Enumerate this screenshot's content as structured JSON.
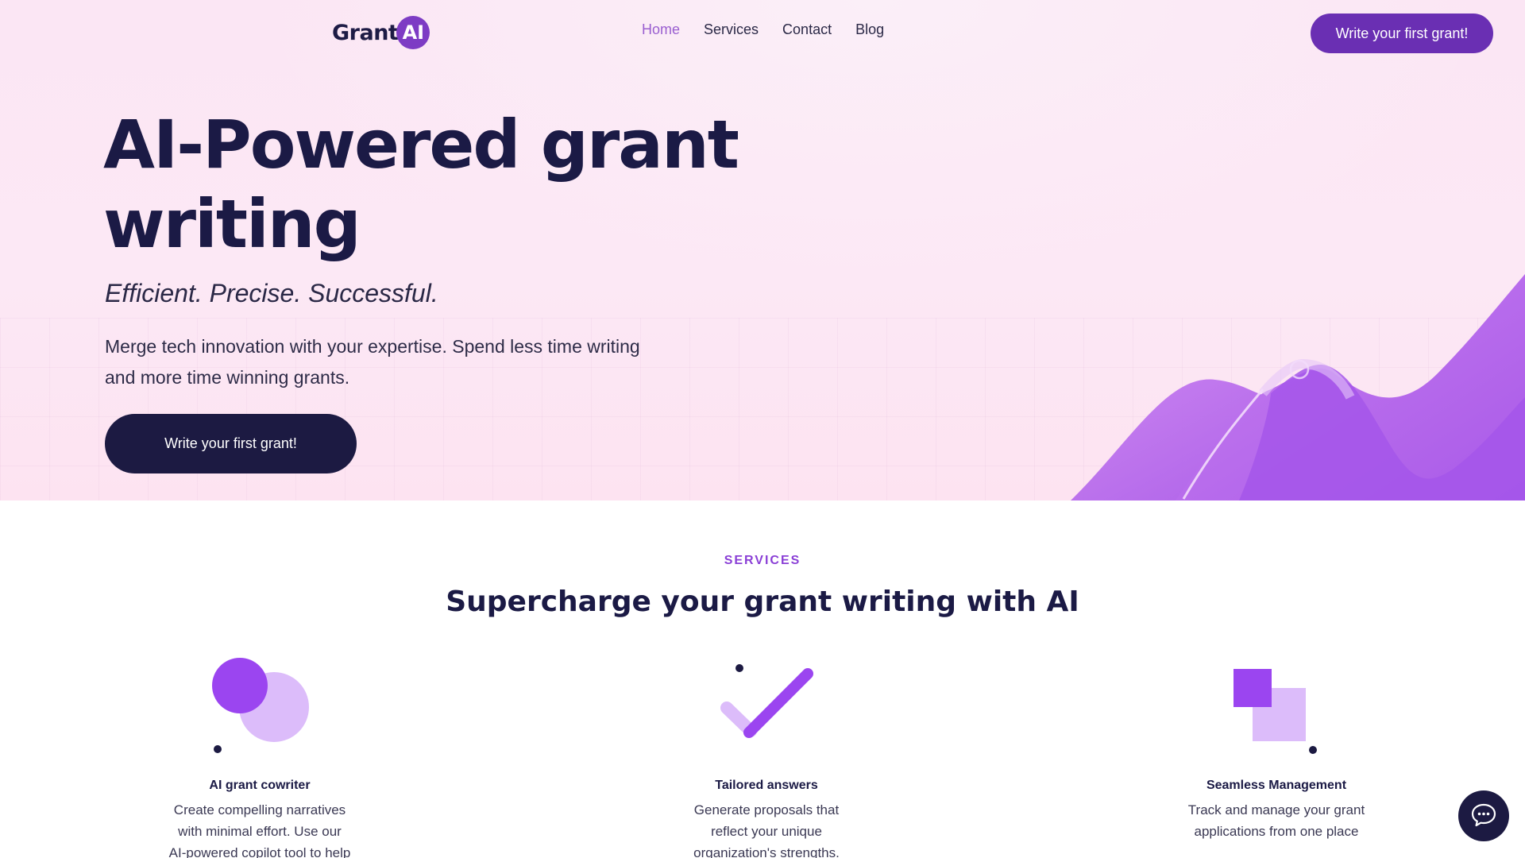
{
  "brand": {
    "name": "Grant",
    "badge": "AI",
    "accent": "#7d3cc4"
  },
  "nav": {
    "items": [
      {
        "label": "Home",
        "active": true
      },
      {
        "label": "Services",
        "active": false
      },
      {
        "label": "Contact",
        "active": false
      },
      {
        "label": "Blog",
        "active": false
      }
    ],
    "cta_label": "Write your first grant!"
  },
  "hero": {
    "title_line1": "AI-Powered grant",
    "title_line2": "writing",
    "tagline": "Efficient. Precise. Successful.",
    "description": "Merge tech innovation with your expertise. Spend less time writing and more time winning grants.",
    "cta_label": "Write your first grant!"
  },
  "services": {
    "eyebrow": "SERVICES",
    "title": "Supercharge your grant writing with AI",
    "cards": [
      {
        "icon": "circles-icon",
        "title": "AI grant cowriter",
        "description": "Create compelling narratives with minimal effort. Use our AI-powered copilot tool to help you craft winning"
      },
      {
        "icon": "checkmark-icon",
        "title": "Tailored answers",
        "description": "Generate proposals that reflect your unique organization's strengths."
      },
      {
        "icon": "squares-icon",
        "title": "Seamless Management",
        "description": "Track and manage your grant applications from one place"
      }
    ]
  },
  "chat": {
    "icon": "chat-bubble-icon"
  },
  "colors": {
    "dark": "#1c1a42",
    "purple": "#6a2fb3",
    "light_purple": "#dcbcfa",
    "violet": "#9b45f0"
  }
}
